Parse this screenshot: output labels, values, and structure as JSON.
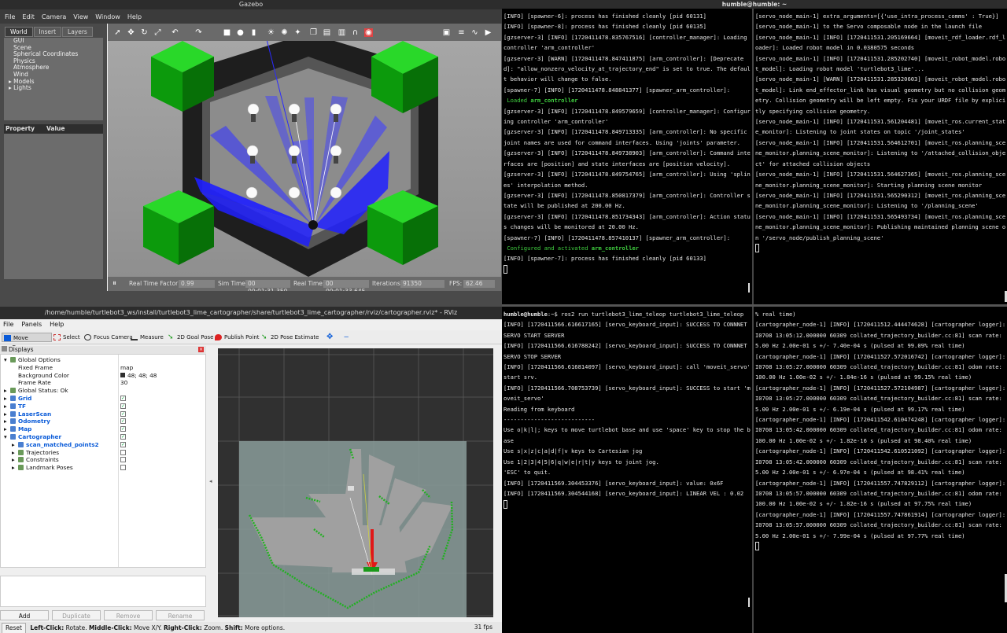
{
  "gazebo": {
    "title": "Gazebo",
    "menu": [
      "File",
      "Edit",
      "Camera",
      "View",
      "Window",
      "Help"
    ],
    "tabs": [
      "World",
      "Insert",
      "Layers"
    ],
    "tree": [
      "GUI",
      "Scene",
      "Spherical Coordinates",
      "Physics",
      "Atmosphere",
      "Wind",
      "Models",
      "Lights"
    ],
    "prop_header": [
      "Property",
      "Value"
    ],
    "status": {
      "pause": "⏸",
      "real_time_factor_label": "Real Time Factor:",
      "real_time_factor": "0.99",
      "sim_time_label": "Sim Time:",
      "sim_time": "00 00:01:31.350",
      "real_time_label": "Real Time:",
      "real_time": "00 00:01:33.645",
      "iterations_label": "Iterations:",
      "iterations": "91350",
      "fps_label": "FPS:",
      "fps": "62.46"
    }
  },
  "rviz": {
    "title": "/home/humble/turtlebot3_ws/install/turtlebot3_lime_cartographer/share/turtlebot3_lime_cartographer/rviz/cartographer.rviz* - RViz",
    "menu": [
      "File",
      "Panels",
      "Help"
    ],
    "tools": [
      "Move Camera",
      "Select",
      "Focus Camera",
      "Measure",
      "2D Goal Pose",
      "Publish Point",
      "2D Pose Estimate"
    ],
    "displays_header": "Displays",
    "rows": [
      {
        "name": "Global Options",
        "value": "",
        "style": "plain",
        "arrow": "▾",
        "indent": 0
      },
      {
        "name": "Fixed Frame",
        "value": "map",
        "style": "plain",
        "arrow": "",
        "indent": 1
      },
      {
        "name": "Background Color",
        "value": "48; 48; 48",
        "style": "plain",
        "arrow": "",
        "indent": 1
      },
      {
        "name": "Frame Rate",
        "value": "30",
        "style": "plain",
        "arrow": "",
        "indent": 1
      },
      {
        "name": "Global Status: Ok",
        "value": "",
        "style": "plain",
        "arrow": "▸",
        "indent": 0
      },
      {
        "name": "Grid",
        "value": "✓",
        "style": "blue",
        "arrow": "▸",
        "indent": 0
      },
      {
        "name": "TF",
        "value": "✓",
        "style": "blue",
        "arrow": "▸",
        "indent": 0
      },
      {
        "name": "LaserScan",
        "value": "✓",
        "style": "blue",
        "arrow": "▸",
        "indent": 0
      },
      {
        "name": "Odometry",
        "value": "✓",
        "style": "blue",
        "arrow": "▸",
        "indent": 0
      },
      {
        "name": "Map",
        "value": "✓",
        "style": "blue",
        "arrow": "▸",
        "indent": 0
      },
      {
        "name": "Cartographer",
        "value": "✓",
        "style": "blue",
        "arrow": "▾",
        "indent": 0
      },
      {
        "name": "scan_matched_points2",
        "value": "✓",
        "style": "blue",
        "arrow": "▸",
        "indent": 1
      },
      {
        "name": "Trajectories",
        "value": "",
        "style": "plain",
        "arrow": "▸",
        "indent": 1
      },
      {
        "name": "Constraints",
        "value": "",
        "style": "plain",
        "arrow": "▸",
        "indent": 1
      },
      {
        "name": "Landmark Poses",
        "value": "",
        "style": "plain",
        "arrow": "▸",
        "indent": 1
      }
    ],
    "buttons": [
      "Add",
      "Duplicate",
      "Remove",
      "Rename"
    ],
    "status": {
      "reset": "Reset",
      "hint_parts": [
        {
          "b": "Left-Click:",
          "t": " Rotate. "
        },
        {
          "b": "Middle-Click:",
          "t": " Move X/Y. "
        },
        {
          "b": "Right-Click:",
          "t": " Zoom. "
        },
        {
          "b": "Shift:",
          "t": " More options."
        }
      ],
      "fps": "31 fps"
    }
  },
  "terminal": {
    "title": "humble@humble: ~",
    "t1": [
      [
        "w",
        "[INFO] [spawner-6]: process has finished cleanly [pid 60131]"
      ],
      [
        "w",
        "[INFO] [spawner-8]: process has finished cleanly [pid 60135]"
      ],
      [
        "w",
        "[gzserver-3] [INFO] [1720411478.835767516] [controller_manager]: Loading controller 'arm_controller'"
      ],
      [
        "w",
        "[gzserver-3] [WARN] [1720411478.847411875] [arm_controller]: [Deprecated]: \"allow_nonzero_velocity_at_trajectory_end\" is set to true. The default behavior will change to false."
      ],
      [
        "w",
        "[spawner-7] [INFO] [1720411478.848841377] [spawner_arm_controller]: "
      ],
      [
        "g",
        " Loaded ",
        "arm_controller"
      ],
      [
        "w",
        "[gzserver-3] [INFO] [1720411478.849579659] [controller_manager]: Configuring controller 'arm_controller'"
      ],
      [
        "w",
        "[gzserver-3] [INFO] [1720411478.849713335] [arm_controller]: No specific joint names are used for command interfaces. Using 'joints' parameter."
      ],
      [
        "w",
        "[gzserver-3] [INFO] [1720411478.849738903] [arm_controller]: Command interfaces are [position] and state interfaces are [position velocity]."
      ],
      [
        "w",
        "[gzserver-3] [INFO] [1720411478.849754765] [arm_controller]: Using 'splines' interpolation method."
      ],
      [
        "w",
        "[gzserver-3] [INFO] [1720411478.850817379] [arm_controller]: Controller state will be published at 200.00 Hz."
      ],
      [
        "w",
        "[gzserver-3] [INFO] [1720411478.851734343] [arm_controller]: Action status changes will be monitored at 20.00 Hz."
      ],
      [
        "w",
        "[spawner-7] [INFO] [1720411478.857410137] [spawner_arm_controller]: "
      ],
      [
        "g",
        " Configured and activated ",
        "arm_controller"
      ],
      [
        "w",
        "[INFO] [spawner-7]: process has finished cleanly [pid 60133]"
      ]
    ],
    "t2": [
      "[servo_node_main-1] extra_arguments=[{'use_intra_process_comms' : True}]",
      "[servo_node_main-1] to the Servo composable node in the launch file",
      "[servo_node_main-1] [INFO] [1720411531.205169664] [moveit_rdf_loader.rdf_loader]: Loaded robot model in 0.0380575 seconds",
      "[servo_node_main-1] [INFO] [1720411531.285202740] [moveit_robot_model.robot_model]: Loading robot model 'turtlebot3_lime'...",
      "[servo_node_main-1] [WARN] [1720411531.285320603] [moveit_robot_model.robot_model]: Link end_effector_link has visual geometry but no collision geometry. Collision geometry will be left empty. Fix your URDF file by explicitly specifying collision geometry.",
      "[servo_node_main-1] [INFO] [1720411531.561204481] [moveit_ros.current_state_monitor]: Listening to joint states on topic '/joint_states'",
      "[servo_node_main-1] [INFO] [1720411531.564612701] [moveit_ros.planning_scene_monitor.planning_scene_monitor]: Listening to '/attached_collision_object' for attached collision objects",
      "[servo_node_main-1] [INFO] [1720411531.564627365] [moveit_ros.planning_scene_monitor.planning_scene_monitor]: Starting planning scene monitor",
      "[servo_node_main-1] [INFO] [1720411531.565290312] [moveit_ros.planning_scene_monitor.planning_scene_monitor]: Listening to '/planning_scene'",
      "[servo_node_main-1] [INFO] [1720411531.565493734] [moveit_ros.planning_scene_monitor.planning_scene_monitor]: Publishing maintained planning scene on '/servo_node/publish_planning_scene'"
    ],
    "t3_prompt": "humble@humble",
    "t3_prompt_rest": ":~$ ros2 run turtlebot3_lime_teleop turtlebot3_lime_teleop",
    "t3": [
      "[INFO] [1720411566.616617165] [servo_keyboard_input]: SUCCESS TO CONNNET SERVO START SERVER",
      "[INFO] [1720411566.616788242] [servo_keyboard_input]: SUCCESS TO CONNNET SERVO STOP SERVER",
      "[INFO] [1720411566.616814097] [servo_keyboard_input]: call 'moveit_servo' start srv.",
      "[INFO] [1720411566.708753739] [servo_keyboard_input]: SUCCESS to start 'moveit_servo'",
      "Reading from keyboard",
      "---------------------------",
      "Use o|k|l|; keys to move turtlebot base and use 'space' key to stop the base",
      "Use s|x|z|c|a|d|f|v keys to Cartesian jog",
      "Use 1|2|3|4|5|6|q|w|e|r|t|y keys to joint jog.",
      "'ESC' to quit.",
      "[INFO] [1720411569.304453376] [servo_keyboard_input]: value: 0x6F",
      "[INFO] [1720411569.304544168] [servo_keyboard_input]: LINEAR VEL : 0.02"
    ],
    "t4": [
      "% real time)",
      "[cartographer_node-1] [INFO] [1720411512.444474628] [cartographer logger]: I0708 13:05:12.000000 60309 collated_trajectory_builder.cc:81] scan rate: 5.00 Hz 2.00e-01 s +/- 7.40e-04 s (pulsed at 99.09% real time)",
      "[cartographer_node-1] [INFO] [1720411527.572016742] [cartographer logger]: I0708 13:05:27.000000 60309 collated_trajectory_builder.cc:81] odom rate: 100.00 Hz 1.00e-02 s +/- 1.84e-16 s (pulsed at 99.15% real time)",
      "[cartographer_node-1] [INFO] [1720411527.572104987] [cartographer logger]: I0708 13:05:27.000000 60309 collated_trajectory_builder.cc:81] scan rate: 5.00 Hz 2.00e-01 s +/- 6.19e-04 s (pulsed at 99.17% real time)",
      "[cartographer_node-1] [INFO] [1720411542.610474248] [cartographer logger]: I0708 13:05:42.000000 60309 collated_trajectory_builder.cc:81] odom rate: 100.00 Hz 1.00e-02 s +/- 1.82e-16 s (pulsed at 98.40% real time)",
      "[cartographer_node-1] [INFO] [1720411542.610521092] [cartographer logger]: I0708 13:05:42.000000 60309 collated_trajectory_builder.cc:81] scan rate: 5.00 Hz 2.00e-01 s +/- 6.97e-04 s (pulsed at 98.41% real time)",
      "[cartographer_node-1] [INFO] [1720411557.747829112] [cartographer logger]: I0708 13:05:57.000000 60309 collated_trajectory_builder.cc:81] odom rate: 100.00 Hz 1.00e-02 s +/- 1.82e-16 s (pulsed at 97.75% real time)",
      "[cartographer_node-1] [INFO] [1720411557.747861914] [cartographer logger]: I0708 13:05:57.000000 60309 collated_trajectory_builder.cc:81] scan rate: 5.00 Hz 2.00e-01 s +/- 7.99e-04 s (pulsed at 97.77% real time)"
    ]
  },
  "colors": {
    "green_block": "#0ea80e",
    "laser_blue": "#1e1eff",
    "rviz_bg": "#303030",
    "map_free": "#8a9c9a",
    "map_wall": "#22b022"
  }
}
